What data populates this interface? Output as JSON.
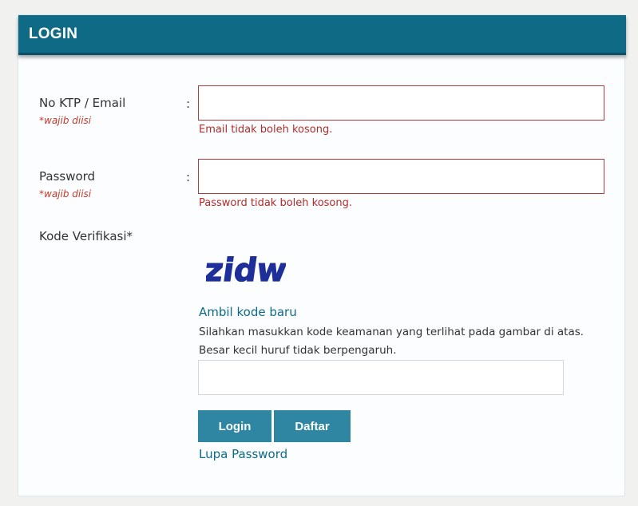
{
  "header": {
    "title": "LOGIN"
  },
  "form": {
    "email": {
      "label": "No KTP / Email",
      "required_note": "*wajib diisi",
      "colon": ":",
      "value": "",
      "error": "Email tidak boleh kosong."
    },
    "password": {
      "label": "Password",
      "required_note": "*wajib diisi",
      "colon": ":",
      "value": "",
      "error": "Password tidak boleh kosong."
    },
    "captcha": {
      "label": "Kode Verifikasi*",
      "image_text": "zidw",
      "refresh_link": "Ambil kode baru",
      "hint_line1": "Silahkan masukkan kode keamanan yang terlihat pada gambar di atas.",
      "hint_line2": "Besar kecil huruf tidak berpengaruh.",
      "value": ""
    },
    "buttons": {
      "login": "Login",
      "register": "Daftar"
    },
    "forgot_password": "Lupa Password"
  },
  "colors": {
    "header_bg": "#0f6a86",
    "button_bg": "#2f86a3",
    "error": "#b32b2b",
    "link": "#0f6a86",
    "captcha_text": "#1f2f9a"
  }
}
